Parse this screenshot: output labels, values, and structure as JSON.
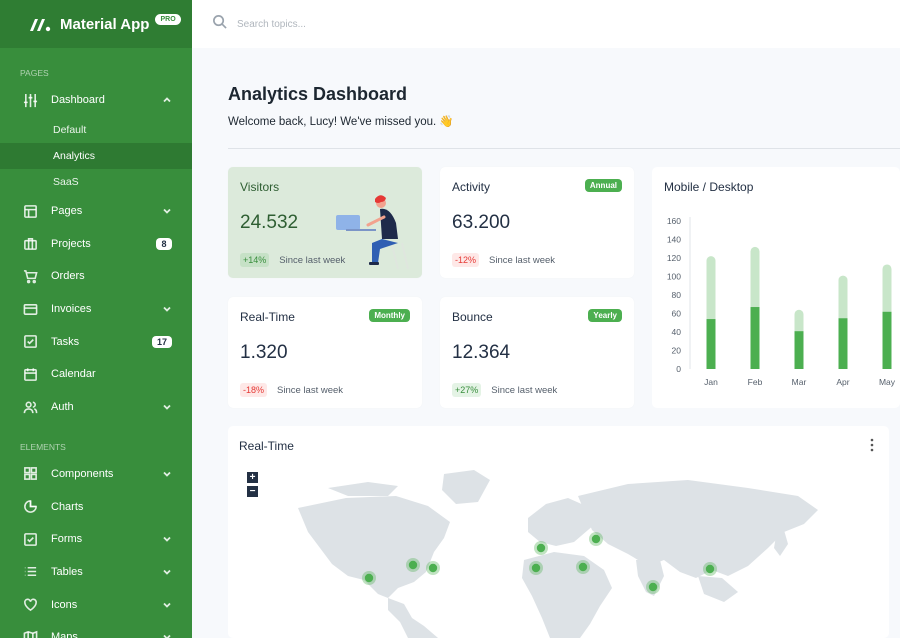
{
  "brand": {
    "name": "Material App",
    "pro": "PRO"
  },
  "sidebar": {
    "section_pages": "Pages",
    "section_elements": "Elements",
    "dashboard": {
      "label": "Dashboard",
      "icon": "sliders-icon",
      "children": [
        "Default",
        "Analytics",
        "SaaS"
      ],
      "active_child": "Analytics"
    },
    "items_pages": [
      {
        "label": "Pages",
        "icon": "layout-icon",
        "chevron": true
      },
      {
        "label": "Projects",
        "icon": "briefcase-icon",
        "badge": "8"
      },
      {
        "label": "Orders",
        "icon": "cart-icon"
      },
      {
        "label": "Invoices",
        "icon": "card-icon",
        "chevron": true
      },
      {
        "label": "Tasks",
        "icon": "check-square-icon",
        "badge": "17"
      },
      {
        "label": "Calendar",
        "icon": "calendar-icon"
      },
      {
        "label": "Auth",
        "icon": "users-icon",
        "chevron": true
      }
    ],
    "items_elements": [
      {
        "label": "Components",
        "icon": "grid-icon",
        "chevron": true
      },
      {
        "label": "Charts",
        "icon": "pie-chart-icon"
      },
      {
        "label": "Forms",
        "icon": "check-square-icon",
        "chevron": true
      },
      {
        "label": "Tables",
        "icon": "list-icon",
        "chevron": true
      },
      {
        "label": "Icons",
        "icon": "heart-icon",
        "chevron": true
      },
      {
        "label": "Maps",
        "icon": "map-icon",
        "chevron": true
      }
    ]
  },
  "search": {
    "placeholder": "Search topics..."
  },
  "page": {
    "title": "Analytics Dashboard",
    "welcome": "Welcome back, Lucy! We've missed you. 👋"
  },
  "stats": {
    "visitors": {
      "title": "Visitors",
      "value": "24.532",
      "change": "+14%",
      "since": "Since last week"
    },
    "activity": {
      "title": "Activity",
      "tag": "Annual",
      "value": "63.200",
      "change": "-12%",
      "since": "Since last week"
    },
    "realtime": {
      "title": "Real-Time",
      "tag": "Monthly",
      "value": "1.320",
      "change": "-18%",
      "since": "Since last week"
    },
    "bounce": {
      "title": "Bounce",
      "tag": "Yearly",
      "value": "12.364",
      "change": "+27%",
      "since": "Since last week"
    }
  },
  "chart_card": {
    "title": "Mobile / Desktop"
  },
  "map_card": {
    "title": "Real-Time",
    "zoom_in": "+",
    "zoom_out": "−"
  },
  "colors": {
    "sidebar": "#388e3c",
    "accent": "#4caf50",
    "bar_dark": "#4caf50",
    "bar_light": "#c8e6c9"
  },
  "chart_data": {
    "type": "bar",
    "stacked": true,
    "categories": [
      "Jan",
      "Feb",
      "Mar",
      "Apr",
      "May"
    ],
    "series": [
      {
        "values": [
          54,
          67,
          41,
          55,
          62
        ]
      },
      {
        "values": [
          68,
          65,
          23,
          46,
          51
        ]
      }
    ],
    "ylim": [
      0,
      160
    ],
    "yticks": [
      0,
      20,
      40,
      60,
      80,
      100,
      120,
      140,
      160
    ],
    "grid": false
  }
}
